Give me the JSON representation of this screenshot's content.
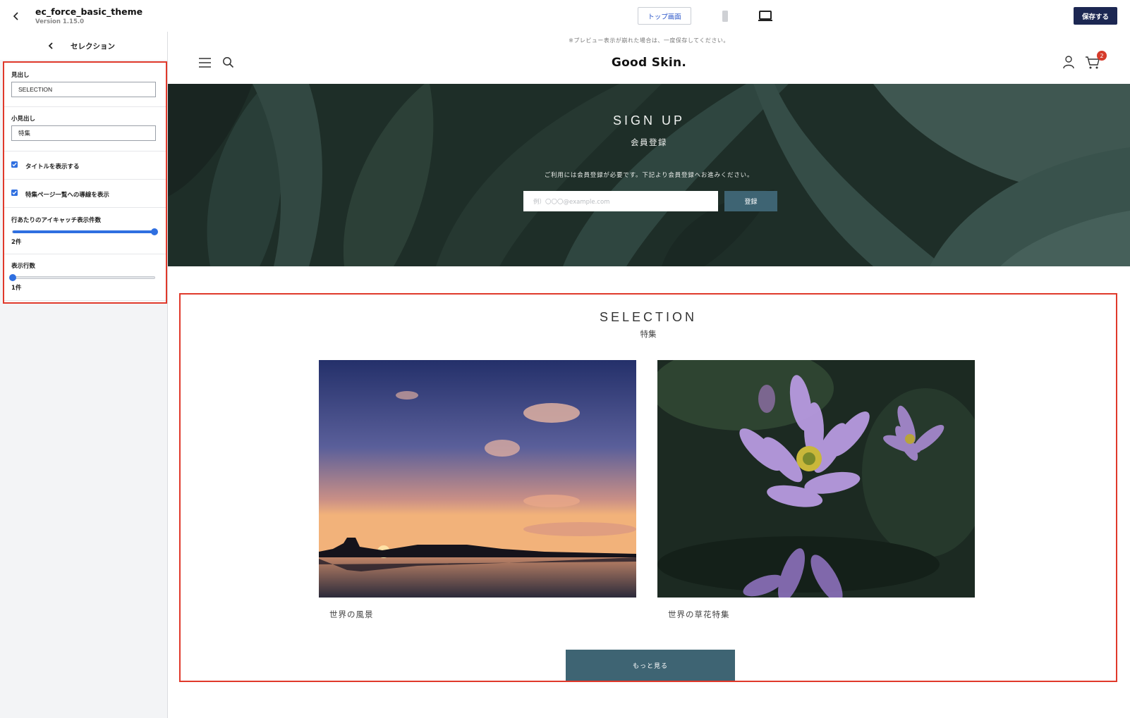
{
  "topbar": {
    "theme_name": "ec_force_basic_theme",
    "theme_version": "Version 1.15.0",
    "page_select": "トップ画面",
    "save_label": "保存する"
  },
  "sidebar": {
    "title": "セレクション",
    "fields": {
      "heading_label": "見出し",
      "heading_value": "SELECTION",
      "subheading_label": "小見出し",
      "subheading_value": "特集",
      "show_title_label": "タイトルを表示する",
      "show_title_checked": true,
      "show_link_label": "特集ページ一覧への導線を表示",
      "show_link_checked": true,
      "per_row_label": "行あたりのアイキャッチ表示件数",
      "per_row_level": 1.0,
      "per_row_value": "2件",
      "rows_label": "表示行数",
      "rows_level": 0.0,
      "rows_value": "1件"
    }
  },
  "preview": {
    "notice": "※プレビュー表示が崩れた場合は、一度保存してください。",
    "logo": "Good Skin.",
    "cart_count": "2",
    "hero": {
      "title": "SIGN UP",
      "subtitle": "会員登録",
      "description": "ご利用には会員登録が必要です。下記より会員登録へお進みください。",
      "email_placeholder": "例）〇〇〇@example.com",
      "register_button": "登録"
    },
    "selection": {
      "title": "SELECTION",
      "subtitle": "特集",
      "items": [
        {
          "title": "世界の風景"
        },
        {
          "title": "世界の草花特集"
        }
      ],
      "more_button": "もっと見る"
    }
  },
  "colors": {
    "save_button": "#1c2752",
    "accent_blue": "#2f6fe0",
    "highlight_red": "#e0392b",
    "teal_button": "#3e6473",
    "cart_badge": "#d63b2b"
  },
  "icons": [
    "back-arrow-icon",
    "mobile-device-icon",
    "desktop-device-icon",
    "menu-icon",
    "search-icon",
    "account-icon",
    "cart-icon",
    "checkbox-check-icon"
  ]
}
